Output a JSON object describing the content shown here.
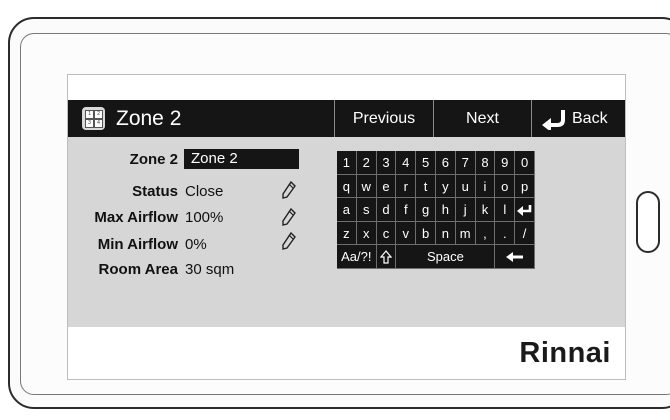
{
  "header": {
    "title": "Zone 2",
    "previous_label": "Previous",
    "next_label": "Next",
    "back_label": "Back",
    "zone_icon_cells": [
      "1",
      "2",
      "3",
      "4"
    ]
  },
  "settings": {
    "zone_name_label": "Zone 2",
    "zone_name_value": "Zone 2",
    "status_label": "Status",
    "status_value": "Close",
    "max_airflow_label": "Max Airflow",
    "max_airflow_value": "100%",
    "min_airflow_label": "Min Airflow",
    "min_airflow_value": "0%",
    "room_area_label": "Room Area",
    "room_area_value": "30 sqm"
  },
  "keyboard": {
    "row1": [
      "1",
      "2",
      "3",
      "4",
      "5",
      "6",
      "7",
      "8",
      "9",
      "0"
    ],
    "row2": [
      "q",
      "w",
      "e",
      "r",
      "t",
      "y",
      "u",
      "i",
      "o",
      "p"
    ],
    "row3": [
      "a",
      "s",
      "d",
      "f",
      "g",
      "h",
      "j",
      "k",
      "l"
    ],
    "row4": [
      "z",
      "x",
      "c",
      "v",
      "b",
      "n",
      "m",
      ",",
      ".",
      "/"
    ],
    "symbols_label": "Aa/?!",
    "space_label": "Space"
  },
  "brand": "Rinnai",
  "icons": {
    "zone": "zone-grid-icon",
    "back": "back-arrow-icon",
    "edit": "pencil-icon",
    "enter": "enter-icon",
    "shift": "shift-icon",
    "backspace": "backspace-icon"
  }
}
